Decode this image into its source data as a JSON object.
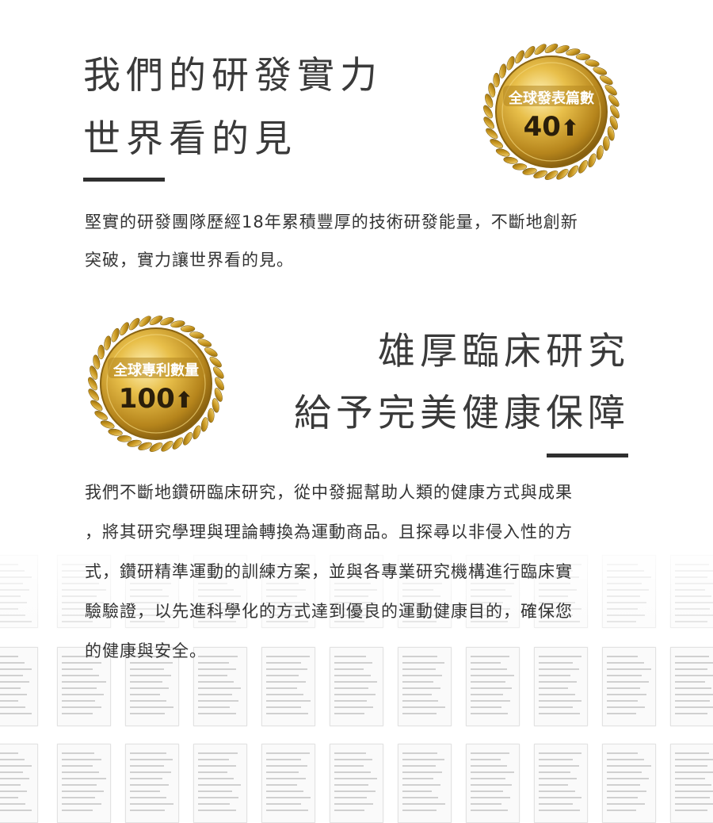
{
  "section1": {
    "heading": [
      "我們的研發實力",
      "世界看的見"
    ],
    "paragraph": [
      "堅實的研發團隊歷經18年累積豐厚的技術研發能量，不斷地創新",
      "突破，實力讓世界看的見。"
    ],
    "medal": {
      "label": "全球發表篇數",
      "value": "40",
      "arrow": "⬆"
    }
  },
  "section2": {
    "heading": [
      "雄厚臨床研究",
      "給予完美健康保障"
    ],
    "paragraph": [
      "我們不斷地鑽研臨床研究，從中發掘幫助人類的健康方式與成果",
      "，將其研究學理與理論轉換為運動商品。且探尋以非侵入性的方",
      "式，鑽研精準運動的訓練方案，並與各專業研究機構進行臨床實",
      "驗驗證，以先進科學化的方式達到優良的運動健康目的，確保您",
      "的健康與安全。"
    ],
    "medal": {
      "label": "全球專利數量",
      "value": "100",
      "arrow": "⬆"
    }
  },
  "colors": {
    "gold": "#d4a62a",
    "gold_dark": "#8a6412",
    "text": "#333333",
    "rule": "#2f2f2f"
  },
  "thumbnails": {
    "icon": "research-paper-thumbnail"
  }
}
